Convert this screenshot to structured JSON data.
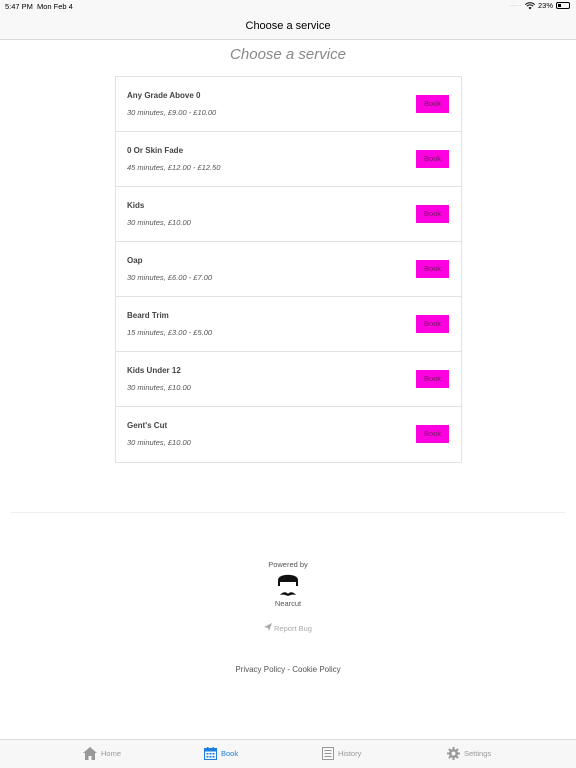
{
  "status_bar": {
    "time": "5:47 PM",
    "date": "Mon Feb 4",
    "battery": "23%"
  },
  "nav": {
    "title": "Choose a service"
  },
  "page": {
    "heading": "Choose a service"
  },
  "book_label": "Book",
  "services": [
    {
      "name": "Any Grade Above 0",
      "detail": "30 minutes, £9.00 - £10.00"
    },
    {
      "name": "0 Or Skin Fade",
      "detail": "45 minutes, £12.00 - £12.50"
    },
    {
      "name": "Kids",
      "detail": "30 minutes, £10.00"
    },
    {
      "name": "Oap",
      "detail": "30 minutes, £6.00 - £7.00"
    },
    {
      "name": "Beard Trim",
      "detail": "15 minutes, £3.00 - £5.00"
    },
    {
      "name": "Kids Under 12",
      "detail": "30 minutes, £10.00"
    },
    {
      "name": "Gent's Cut",
      "detail": "30 minutes, £10.00"
    }
  ],
  "footer": {
    "powered_by": "Powered by",
    "brand": "Nearcut",
    "report_bug": "Report Bug",
    "privacy_policy": "Privacy Policy",
    "separator": " - ",
    "cookie_policy": "Cookie Policy"
  },
  "tabs": {
    "home": "Home",
    "book": "Book",
    "history": "History",
    "settings": "Settings"
  },
  "colors": {
    "book_button": "#ff00e0",
    "active_tab": "#1a7fe0"
  }
}
